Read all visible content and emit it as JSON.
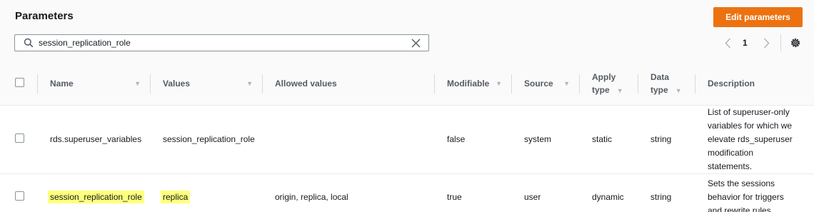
{
  "panel": {
    "title": "Parameters",
    "edit_button": "Edit parameters"
  },
  "search": {
    "value": "session_replication_role",
    "icon": "search-icon",
    "clear_icon": "close-icon"
  },
  "pagination": {
    "current_page": "1"
  },
  "table": {
    "columns": [
      {
        "label": "Name"
      },
      {
        "label": "Values"
      },
      {
        "label": "Allowed values"
      },
      {
        "label": "Modifiable"
      },
      {
        "label": "Source"
      },
      {
        "label_line1": "Apply",
        "label_line2": "type"
      },
      {
        "label_line1": "Data",
        "label_line2": "type"
      },
      {
        "label": "Description"
      }
    ],
    "rows": [
      {
        "name": "rds.superuser_variables",
        "values": "session_replication_role",
        "allowed_values": "",
        "modifiable": "false",
        "source": "system",
        "apply_type": "static",
        "data_type": "string",
        "description": "List of superuser-only variables for which we elevate rds_superuser modification statements."
      },
      {
        "name": "session_replication_role",
        "values": "replica",
        "allowed_values": "origin, replica, local",
        "modifiable": "true",
        "source": "user",
        "apply_type": "dynamic",
        "data_type": "string",
        "description": "Sets the sessions behavior for triggers and rewrite rules."
      }
    ]
  },
  "colors": {
    "accent": "#ec7211",
    "highlight": "#ffff7d"
  }
}
